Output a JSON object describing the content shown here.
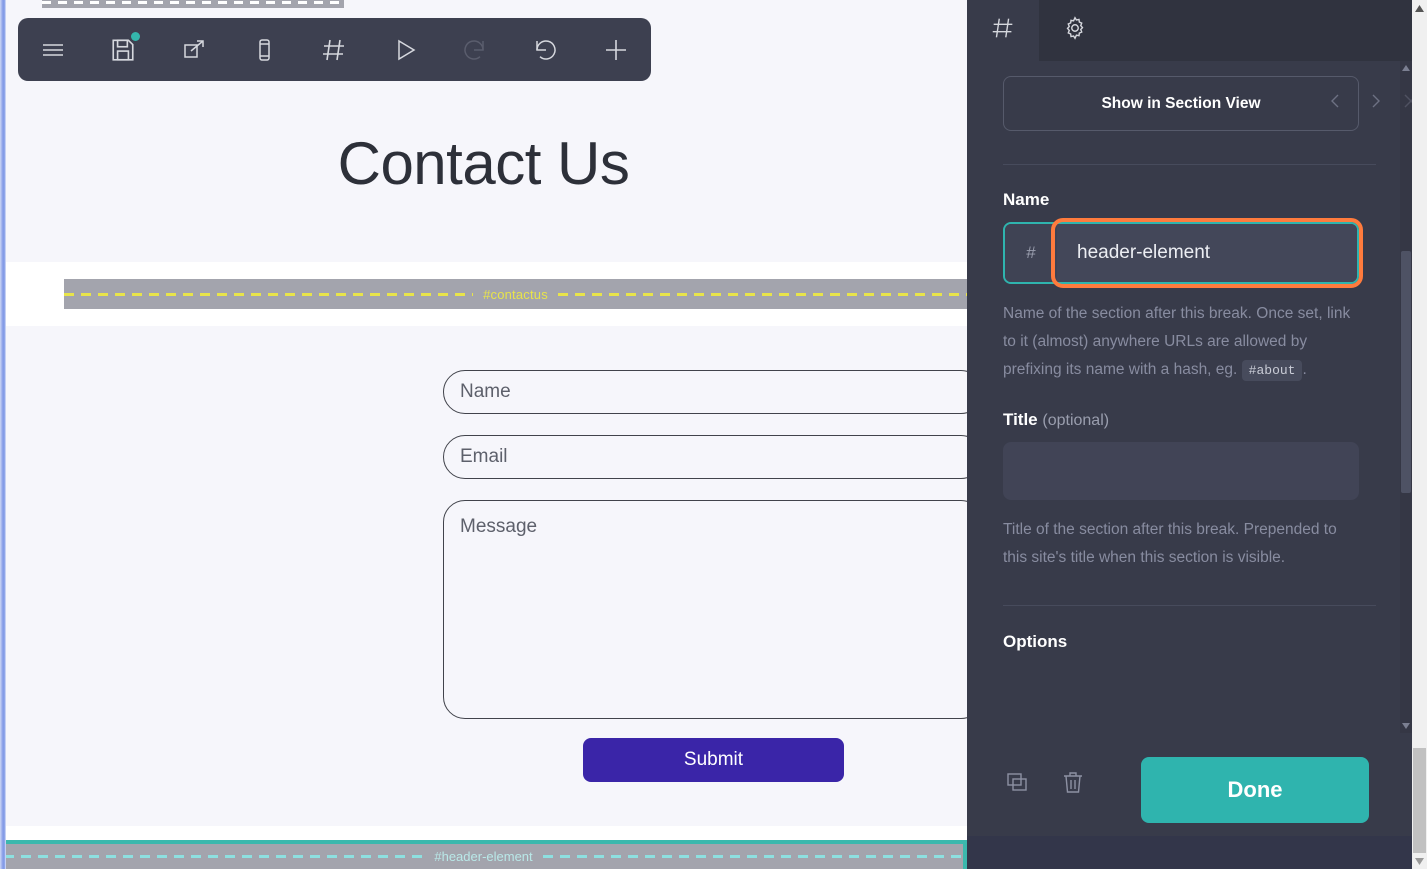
{
  "toolbar": {
    "buttons": [
      {
        "name": "menu",
        "icon": "hamburger-menu-icon",
        "state": "enabled"
      },
      {
        "name": "save",
        "icon": "save-floppy-icon",
        "state": "enabled",
        "badge": "unsaved-changes-dot"
      },
      {
        "name": "open-external",
        "icon": "external-link-icon",
        "state": "enabled"
      },
      {
        "name": "mobile-preview",
        "icon": "mobile-device-icon",
        "state": "enabled"
      },
      {
        "name": "section-break",
        "icon": "hash-icon",
        "state": "enabled"
      },
      {
        "name": "preview-play",
        "icon": "play-triangle-icon",
        "state": "enabled"
      },
      {
        "name": "redo",
        "icon": "redo-arrow-icon",
        "state": "disabled"
      },
      {
        "name": "undo",
        "icon": "undo-arrow-icon",
        "state": "enabled"
      },
      {
        "name": "add",
        "icon": "plus-icon",
        "state": "enabled"
      }
    ]
  },
  "canvas": {
    "hero_title": "Contact Us",
    "break_top": {
      "label": ""
    },
    "break_contactus": {
      "label": "#contactus"
    },
    "break_header_element": {
      "label": "#header-element",
      "selected": true
    },
    "form": {
      "name_placeholder": "Name",
      "email_placeholder": "Email",
      "message_placeholder": "Message",
      "submit_label": "Submit"
    }
  },
  "panel": {
    "tabs": [
      {
        "label": "",
        "icon": "hash-icon",
        "active": true
      },
      {
        "label": "",
        "icon": "gear-icon",
        "active": false
      }
    ],
    "show_in_section_view": "Show in Section View",
    "nav_prev_icon": "chevron-left-icon",
    "nav_next_icon": "chevron-right-icon",
    "close_icon": "close-x-icon",
    "name": {
      "label": "Name",
      "prefix": "#",
      "value": "header-element",
      "help_1": "Name of the section after this break. Once set,",
      "help_2": "link to it (almost) anywhere URLs are allowed by",
      "help_3": "prefixing its name with a hash, eg.",
      "help_code": "#about",
      "help_4": "."
    },
    "title": {
      "label": "Title",
      "optional": "(optional)",
      "value": "",
      "placeholder": "",
      "help_1": "Title of the section after this break. Prepended to",
      "help_2": "this site's title when this section is visible."
    },
    "options_heading": "Options",
    "footer": {
      "duplicate_icon": "duplicate-copy-icon",
      "delete_icon": "trash-delete-icon",
      "done_label": "Done"
    }
  },
  "colors": {
    "panel_bg": "#383b4a",
    "panel_tabbar_bg": "#30333f",
    "accent_teal": "#2fb4ae",
    "focus_orange": "#ff7b3d",
    "submit_indigo": "#3a25a8",
    "marker_yellow": "#e8e44a",
    "marker_cyan": "#8de0e0",
    "toolbar_bg": "#3d4050"
  }
}
